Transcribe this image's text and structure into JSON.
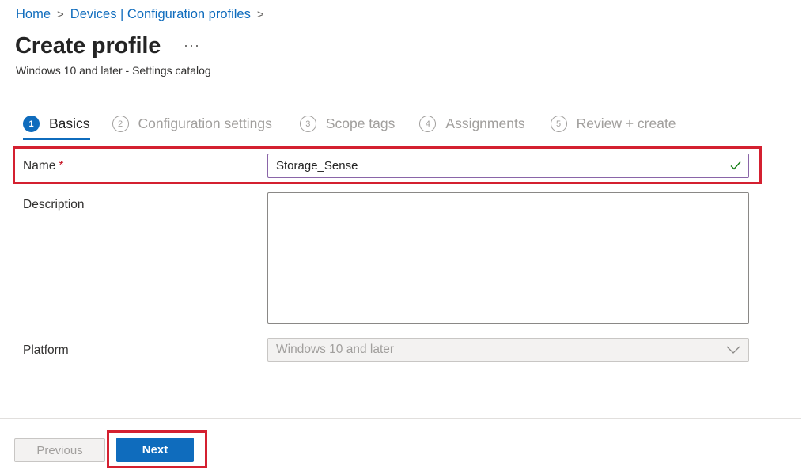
{
  "breadcrumb": {
    "items": [
      "Home",
      "Devices | Configuration profiles"
    ],
    "separator": ">"
  },
  "header": {
    "title": "Create profile",
    "more": "···",
    "subtitle": "Windows 10 and later - Settings catalog"
  },
  "steps": [
    {
      "num": "1",
      "label": "Basics",
      "active": true
    },
    {
      "num": "2",
      "label": "Configuration settings",
      "active": false
    },
    {
      "num": "3",
      "label": "Scope tags",
      "active": false
    },
    {
      "num": "4",
      "label": "Assignments",
      "active": false
    },
    {
      "num": "5",
      "label": "Review + create",
      "active": false
    }
  ],
  "form": {
    "name_label": "Name",
    "required_mark": "*",
    "name_value": "Storage_Sense",
    "description_label": "Description",
    "description_value": "",
    "platform_label": "Platform",
    "platform_value": "Windows 10 and later"
  },
  "footer": {
    "previous_label": "Previous",
    "next_label": "Next"
  },
  "colors": {
    "accent": "#0f6cbd",
    "highlight": "#d42030",
    "valid_check": "#107c10",
    "required": "#c50f1f"
  }
}
